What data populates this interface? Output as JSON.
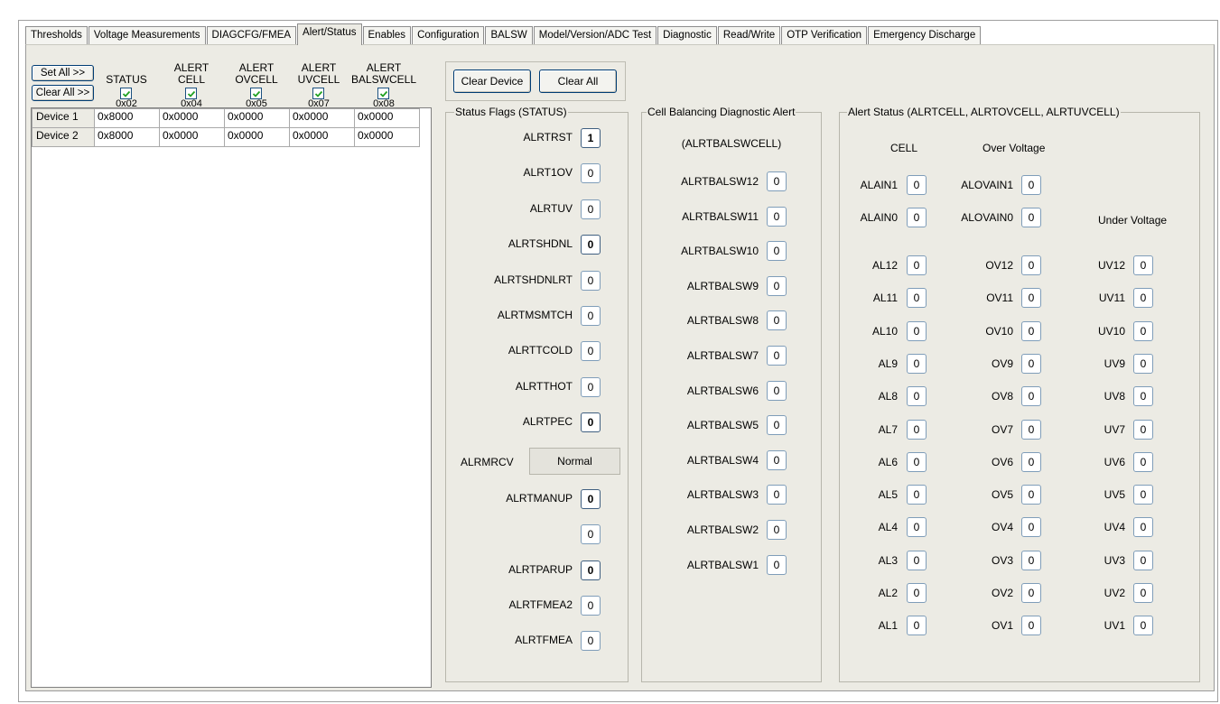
{
  "tabs": [
    "Thresholds",
    "Voltage Measurements",
    "DIAGCFG/FMEA",
    "Alert/Status",
    "Enables",
    "Configuration",
    "BALSW",
    "Model/Version/ADC Test",
    "Diagnostic",
    "Read/Write",
    "OTP Verification",
    "Emergency Discharge"
  ],
  "active_tab": "Alert/Status",
  "left": {
    "set_all_label": "Set All >>",
    "clear_all_label": "Clear All >>",
    "columns": [
      {
        "line1": "",
        "line2": "STATUS",
        "addr": "0x02",
        "checked": true
      },
      {
        "line1": "ALERT",
        "line2": "CELL",
        "addr": "0x04",
        "checked": true
      },
      {
        "line1": "ALERT",
        "line2": "OVCELL",
        "addr": "0x05",
        "checked": true
      },
      {
        "line1": "ALERT",
        "line2": "UVCELL",
        "addr": "0x07",
        "checked": true
      },
      {
        "line1": "ALERT",
        "line2": "BALSWCELL",
        "addr": "0x08",
        "checked": true
      }
    ],
    "rows": [
      {
        "name": "Device 1",
        "values": [
          "0x8000",
          "0x0000",
          "0x0000",
          "0x0000",
          "0x0000"
        ]
      },
      {
        "name": "Device 2",
        "values": [
          "0x8000",
          "0x0000",
          "0x0000",
          "0x0000",
          "0x0000"
        ]
      }
    ]
  },
  "buttons": {
    "clear_device": "Clear Device",
    "clear_all": "Clear All"
  },
  "status": {
    "title": "Status Flags (STATUS)",
    "flags": [
      {
        "label": "ALRTRST",
        "value": "1",
        "bold": true
      },
      {
        "label": "ALRT1OV",
        "value": "0",
        "bold": false
      },
      {
        "label": "ALRTUV",
        "value": "0",
        "bold": false
      },
      {
        "label": "ALRTSHDNL",
        "value": "0",
        "bold": true
      },
      {
        "label": "ALRTSHDNLRT",
        "value": "0",
        "bold": false
      },
      {
        "label": "ALRTMSMTCH",
        "value": "0",
        "bold": false
      },
      {
        "label": "ALRTTCOLD",
        "value": "0",
        "bold": false
      },
      {
        "label": "ALRTTHOT",
        "value": "0",
        "bold": false
      },
      {
        "label": "ALRTPEC",
        "value": "0",
        "bold": true
      }
    ],
    "mrcv_label": "ALRMRCV",
    "mrcv_value": "Normal",
    "lower_flags": [
      {
        "label": "ALRTMANUP",
        "value": "0",
        "bold": true
      },
      {
        "label": "",
        "value": "0",
        "bold": false
      },
      {
        "label": "ALRTPARUP",
        "value": "0",
        "bold": true
      },
      {
        "label": "ALRTFMEA2",
        "value": "0",
        "bold": false
      },
      {
        "label": "ALRTFMEA",
        "value": "0",
        "bold": false
      }
    ]
  },
  "balancing": {
    "title": "Cell Balancing Diagnostic Alert",
    "subtitle": "(ALRTBALSWCELL)",
    "items": [
      {
        "label": "ALRTBALSW12",
        "value": "0"
      },
      {
        "label": "ALRTBALSW11",
        "value": "0"
      },
      {
        "label": "ALRTBALSW10",
        "value": "0"
      },
      {
        "label": "ALRTBALSW9",
        "value": "0"
      },
      {
        "label": "ALRTBALSW8",
        "value": "0"
      },
      {
        "label": "ALRTBALSW7",
        "value": "0"
      },
      {
        "label": "ALRTBALSW6",
        "value": "0"
      },
      {
        "label": "ALRTBALSW5",
        "value": "0"
      },
      {
        "label": "ALRTBALSW4",
        "value": "0"
      },
      {
        "label": "ALRTBALSW3",
        "value": "0"
      },
      {
        "label": "ALRTBALSW2",
        "value": "0"
      },
      {
        "label": "ALRTBALSW1",
        "value": "0"
      }
    ]
  },
  "alert_status": {
    "title": "Alert Status (ALRTCELL, ALRTOVCELL, ALRTUVCELL)",
    "cell_header": "CELL",
    "ov_header": "Over Voltage",
    "uv_header": "Under Voltage",
    "ain_rows": [
      {
        "cell_label": "ALAIN1",
        "cell_value": "0",
        "ov_label": "ALOVAIN1",
        "ov_value": "0"
      },
      {
        "cell_label": "ALAIN0",
        "cell_value": "0",
        "ov_label": "ALOVAIN0",
        "ov_value": "0"
      }
    ],
    "rows": [
      {
        "al": "AL12",
        "al_v": "0",
        "ov": "OV12",
        "ov_v": "0",
        "uv": "UV12",
        "uv_v": "0"
      },
      {
        "al": "AL11",
        "al_v": "0",
        "ov": "OV11",
        "ov_v": "0",
        "uv": "UV11",
        "uv_v": "0"
      },
      {
        "al": "AL10",
        "al_v": "0",
        "ov": "OV10",
        "ov_v": "0",
        "uv": "UV10",
        "uv_v": "0"
      },
      {
        "al": "AL9",
        "al_v": "0",
        "ov": "OV9",
        "ov_v": "0",
        "uv": "UV9",
        "uv_v": "0"
      },
      {
        "al": "AL8",
        "al_v": "0",
        "ov": "OV8",
        "ov_v": "0",
        "uv": "UV8",
        "uv_v": "0"
      },
      {
        "al": "AL7",
        "al_v": "0",
        "ov": "OV7",
        "ov_v": "0",
        "uv": "UV7",
        "uv_v": "0"
      },
      {
        "al": "AL6",
        "al_v": "0",
        "ov": "OV6",
        "ov_v": "0",
        "uv": "UV6",
        "uv_v": "0"
      },
      {
        "al": "AL5",
        "al_v": "0",
        "ov": "OV5",
        "ov_v": "0",
        "uv": "UV5",
        "uv_v": "0"
      },
      {
        "al": "AL4",
        "al_v": "0",
        "ov": "OV4",
        "ov_v": "0",
        "uv": "UV4",
        "uv_v": "0"
      },
      {
        "al": "AL3",
        "al_v": "0",
        "ov": "OV3",
        "ov_v": "0",
        "uv": "UV3",
        "uv_v": "0"
      },
      {
        "al": "AL2",
        "al_v": "0",
        "ov": "OV2",
        "ov_v": "0",
        "uv": "UV2",
        "uv_v": "0"
      },
      {
        "al": "AL1",
        "al_v": "0",
        "ov": "OV1",
        "ov_v": "0",
        "uv": "UV1",
        "uv_v": "0"
      }
    ]
  },
  "colors": {
    "panel": "#ecebe4",
    "checkmark": "#21a121",
    "border_dark": "#003c74"
  }
}
